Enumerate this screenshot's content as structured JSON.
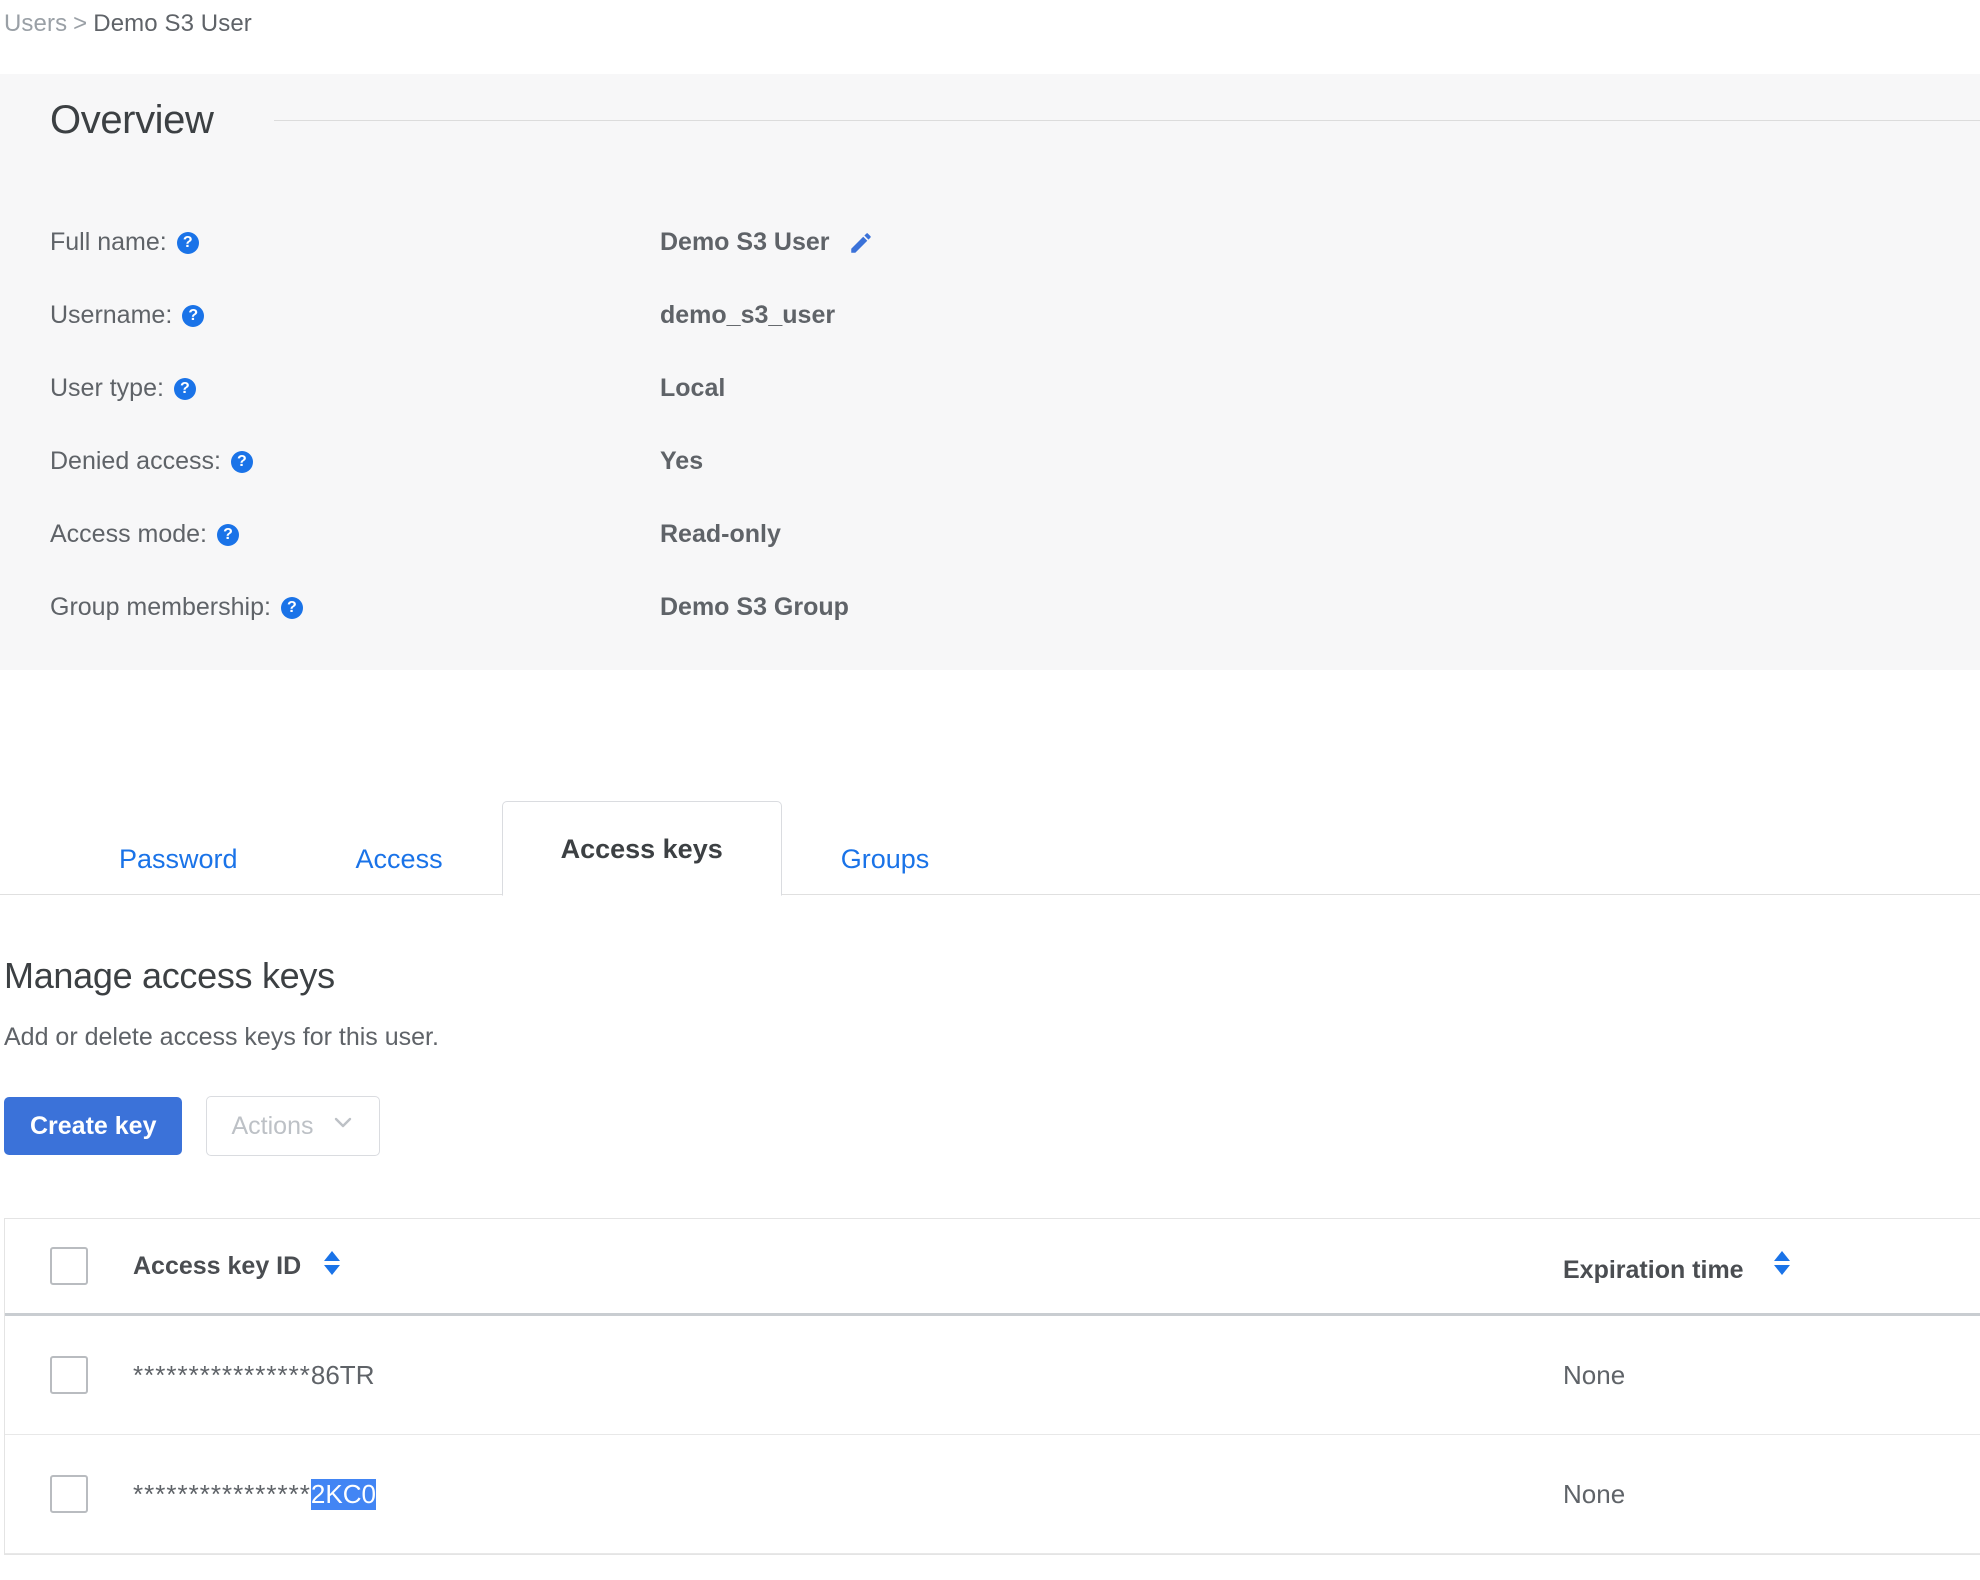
{
  "breadcrumb": {
    "root": "Users",
    "separator": ">",
    "current": "Demo S3 User"
  },
  "overview": {
    "title": "Overview",
    "help_icon_glyph": "?",
    "edit_icon": "pencil-icon",
    "fields": [
      {
        "label": "Full name:",
        "value": "Demo S3 User",
        "editable": true
      },
      {
        "label": "Username:",
        "value": "demo_s3_user",
        "editable": false
      },
      {
        "label": "User type:",
        "value": "Local",
        "editable": false
      },
      {
        "label": "Denied access:",
        "value": "Yes",
        "editable": false
      },
      {
        "label": "Access mode:",
        "value": "Read-only",
        "editable": false
      },
      {
        "label": "Group membership:",
        "value": "Demo S3 Group",
        "editable": false
      }
    ]
  },
  "tabs": [
    {
      "label": "Password",
      "active": false
    },
    {
      "label": "Access",
      "active": false
    },
    {
      "label": "Access keys",
      "active": true
    },
    {
      "label": "Groups",
      "active": false
    }
  ],
  "main": {
    "heading": "Manage access keys",
    "subheading": "Add or delete access keys for this user.",
    "create_button": "Create key",
    "actions_button": "Actions",
    "actions_disabled": true
  },
  "table": {
    "columns": [
      {
        "label": "Access key ID",
        "sortable": true
      },
      {
        "label": "Expiration time",
        "sortable": true
      }
    ],
    "rows": [
      {
        "mask": "****************",
        "tail": "86TR",
        "tail_selected": false,
        "expiration": "None",
        "checked": false
      },
      {
        "mask": "****************",
        "tail": "2KC0",
        "tail_selected": true,
        "expiration": "None",
        "checked": false
      }
    ]
  },
  "colors": {
    "accent_blue": "#1a73e8",
    "primary_button": "#3b72d9",
    "selection_blue": "#4285f4",
    "panel_bg": "#f7f7f8",
    "label_gray": "#5f6368"
  }
}
